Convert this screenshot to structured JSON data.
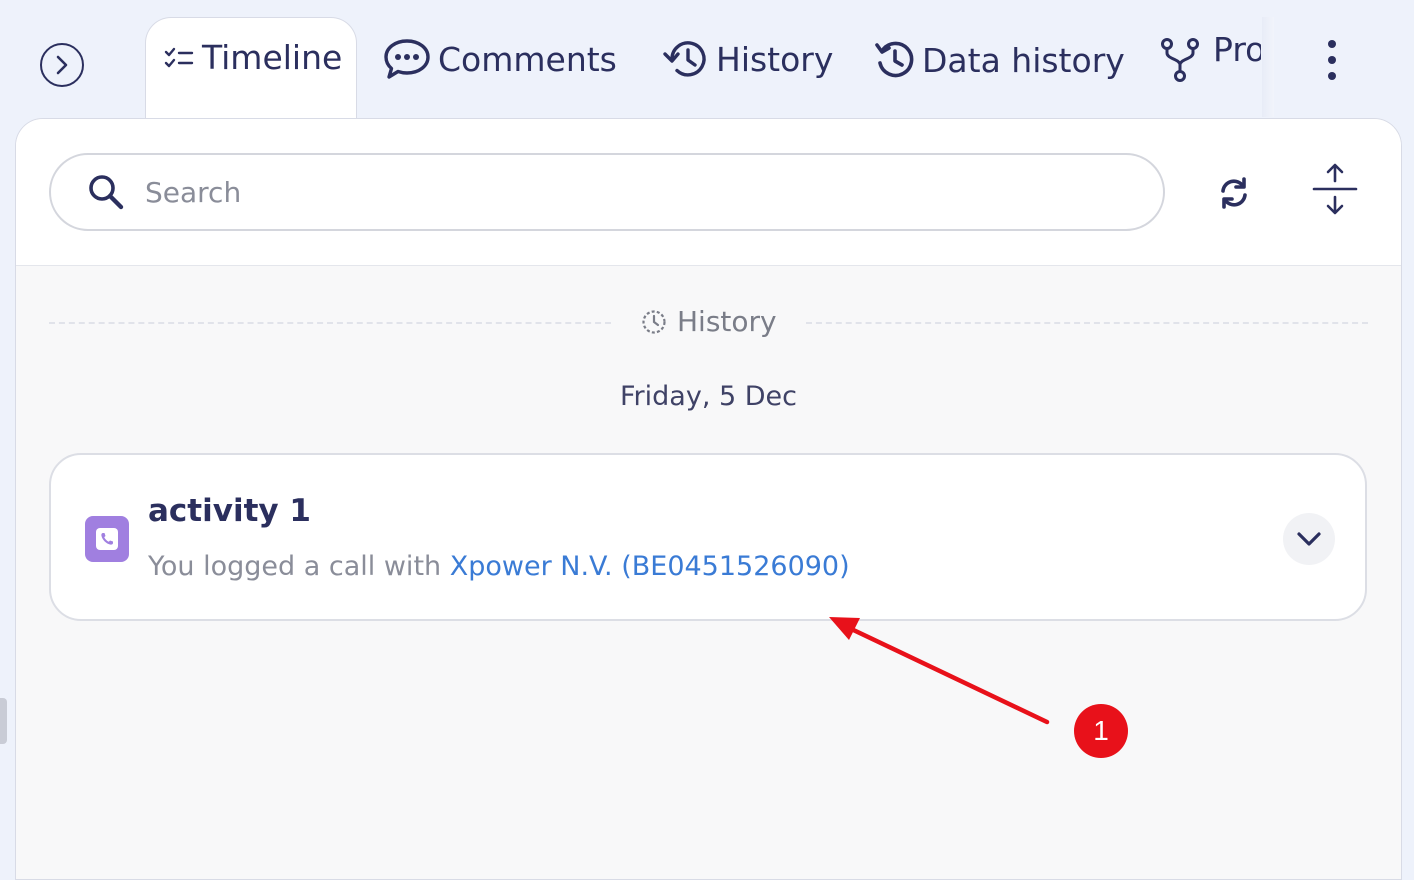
{
  "tabs": [
    {
      "id": "timeline",
      "label": "Timeline",
      "icon": "checklist-icon",
      "active": true
    },
    {
      "id": "comments",
      "label": "Comments",
      "icon": "comment-bubble-icon"
    },
    {
      "id": "history",
      "label": "History",
      "icon": "history-clock-icon"
    },
    {
      "id": "data-history",
      "label": "Data history",
      "icon": "restore-clock-icon"
    },
    {
      "id": "processes",
      "label": "Pro",
      "icon": "branch-icon"
    }
  ],
  "search": {
    "placeholder": "Search"
  },
  "section": {
    "label": "History",
    "icon": "dashed-clock-icon"
  },
  "date": "Friday, 5 Dec",
  "activity": {
    "title": "activity 1",
    "prefix": "You logged a call with ",
    "link": "Xpower N.V. (BE0451526090)",
    "icon": "phone-icon"
  },
  "annotation": {
    "badge": "1",
    "color": "#e8111a"
  },
  "colors": {
    "text": "#2b2f5e",
    "link": "#3a7bd5",
    "accent": "#a07fe0",
    "background": "#eef2fb"
  }
}
